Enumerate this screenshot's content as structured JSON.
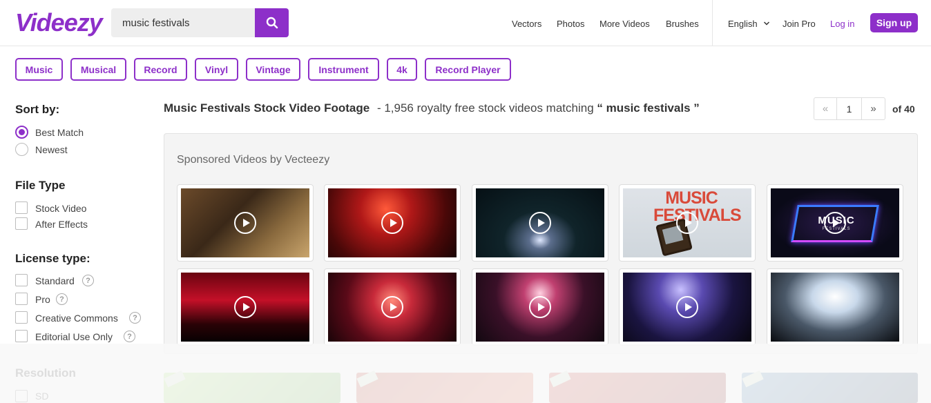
{
  "header": {
    "logo": "Videezy",
    "search": {
      "value": "music festivals"
    },
    "nav": [
      "Vectors",
      "Photos",
      "More Videos",
      "Brushes"
    ],
    "language": "English",
    "join_pro": "Join Pro",
    "login": "Log in",
    "signup": "Sign up"
  },
  "tags": [
    "Music",
    "Musical",
    "Record",
    "Vinyl",
    "Vintage",
    "Instrument",
    "4k",
    "Record Player"
  ],
  "sidebar": {
    "sort_heading": "Sort by:",
    "sort_options": [
      {
        "label": "Best Match",
        "selected": true
      },
      {
        "label": "Newest",
        "selected": false
      }
    ],
    "file_type_heading": "File Type",
    "file_types": [
      "Stock Video",
      "After Effects"
    ],
    "license_heading": "License type:",
    "licenses": [
      "Standard",
      "Pro",
      "Creative Commons",
      "Editorial Use Only"
    ],
    "resolution_heading": "Resolution",
    "resolutions": [
      "SD"
    ]
  },
  "results": {
    "title": "Music Festivals Stock Video Footage",
    "count_text": "- 1,956 royalty free stock videos matching",
    "query_open": "“",
    "query": "music festivals",
    "query_close": "”"
  },
  "pager": {
    "prev": "«",
    "current": "1",
    "next": "»",
    "total": "of 40"
  },
  "sponsored": {
    "heading": "Sponsored Videos by Vecteezy",
    "thumbs": [
      {
        "name": "child-on-bench",
        "bg": "linear-gradient(135deg,#6b4a2a 0%,#3a2818 40%,#8a6a3e 70%,#c9a56d 100%)"
      },
      {
        "name": "red-stage-crowd",
        "bg": "radial-gradient(circle at 45% 30%,#ff5a3a 0%,#b01818 30%,#4a0808 70%,#1a0404 100%)"
      },
      {
        "name": "night-stage-lights",
        "bg": "radial-gradient(ellipse at 50% 75%,#dfe8ff 0%,#5b6d8c 12%,#10242a 40%,#061015 100%)"
      },
      {
        "name": "music-festivals-tv",
        "bg": "linear-gradient(180deg,#dfe3e8 0%,#cfd6dc 100%)"
      },
      {
        "name": "neon-festival-frame",
        "bg": "radial-gradient(ellipse at 50% 50%,#2a1a4a 0%,#0a0a18 70%)"
      },
      {
        "name": "red-crowd-silhouette",
        "bg": "linear-gradient(180deg,#6a0410 0%,#c41028 40%,#2a0206 75%,#080102 100%)"
      },
      {
        "name": "red-band-stage",
        "bg": "radial-gradient(circle at 50% 40%,#ff8a7a 0%,#c82a3a 25%,#5a0a18 60%,#1a0408 100%)"
      },
      {
        "name": "pink-lights-hands",
        "bg": "radial-gradient(circle at 50% 30%,#ffd0e0 0%,#c04070 20%,#3a1028 55%,#120810 100%)"
      },
      {
        "name": "blue-concert-band",
        "bg": "radial-gradient(circle at 45% 25%,#c8c0ff 0%,#5a4ab0 25%,#1a1440 60%,#08060f 100%)"
      },
      {
        "name": "white-light-crowd",
        "bg": "radial-gradient(ellipse at 50% 35%,#ffffff 0%,#c8d8ea 25%,#4a5868 55%,#0a0c10 100%)"
      }
    ],
    "tv_text": "MUSIC FESTIVALS",
    "neon_text": "MUSIC",
    "neon_sub": "FESTIVALS"
  },
  "colors": {
    "brand": "#8d2fc9",
    "accent_text": "#8d2fc9",
    "nav_text": "#333333"
  }
}
